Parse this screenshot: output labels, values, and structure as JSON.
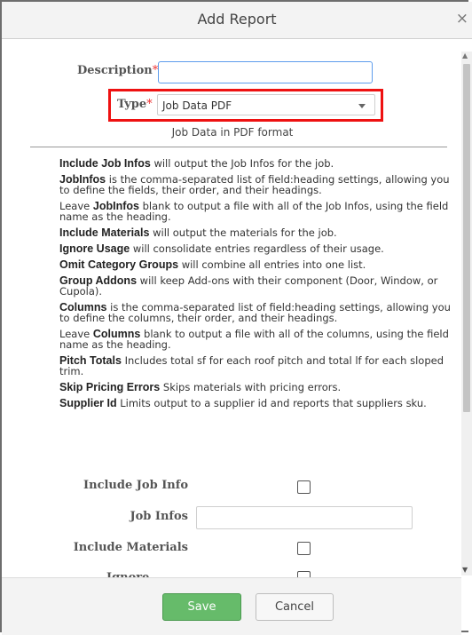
{
  "dialog": {
    "title": "Add Report",
    "close_glyph": "×"
  },
  "form": {
    "description": {
      "label": "Description",
      "required_mark": "*",
      "value": ""
    },
    "type": {
      "label": "Type",
      "required_mark": "*",
      "selected": "Job Data PDF",
      "description": "Job Data in PDF format"
    }
  },
  "help": [
    {
      "term": "Include Job Infos",
      "text": " will output the Job Infos for the job."
    },
    {
      "term": "JobInfos",
      "text": " is the comma-separated list of field:heading settings, allowing you to define the fields, their order, and their headings."
    },
    {
      "pre": "Leave ",
      "term": "JobInfos",
      "text": " blank to output a file with all of the Job Infos, using the field name as the heading."
    },
    {
      "term": "Include Materials",
      "text": " will output the materials for the job."
    },
    {
      "term": "Ignore Usage",
      "text": " will consolidate entries regardless of their usage."
    },
    {
      "term": "Omit Category Groups",
      "text": " will combine all entries into one list."
    },
    {
      "term": "Group Addons",
      "text": " will keep Add-ons with their component (Door, Window, or Cupola)."
    },
    {
      "term": "Columns",
      "text": " is the comma-separated list of field:heading settings, allowing you to define the columns, their order, and their headings."
    },
    {
      "pre": "Leave ",
      "term": "Columns",
      "text": " blank to output a file with all of the columns, using the field name as the heading."
    },
    {
      "term": "Pitch Totals",
      "text": " Includes total sf for each roof pitch and total lf for each sloped trim."
    },
    {
      "term": "Skip Pricing Errors",
      "text": " Skips materials with pricing errors."
    },
    {
      "term": "Supplier Id",
      "text": " Limits output to a supplier id and reports that suppliers sku."
    }
  ],
  "fields": {
    "include_job_info": {
      "label": "Include Job Info",
      "checked": false
    },
    "job_infos": {
      "label": "Job Infos",
      "value": ""
    },
    "include_materials": {
      "label": "Include Materials",
      "checked": false
    },
    "ignore_usage": {
      "label": "Ignore Usage",
      "checked": false
    }
  },
  "footer": {
    "save_label": "Save",
    "cancel_label": "Cancel"
  },
  "colors": {
    "save_green": "#66bb6a",
    "highlight_red": "#e11111",
    "focus_blue": "#5d9cec"
  }
}
